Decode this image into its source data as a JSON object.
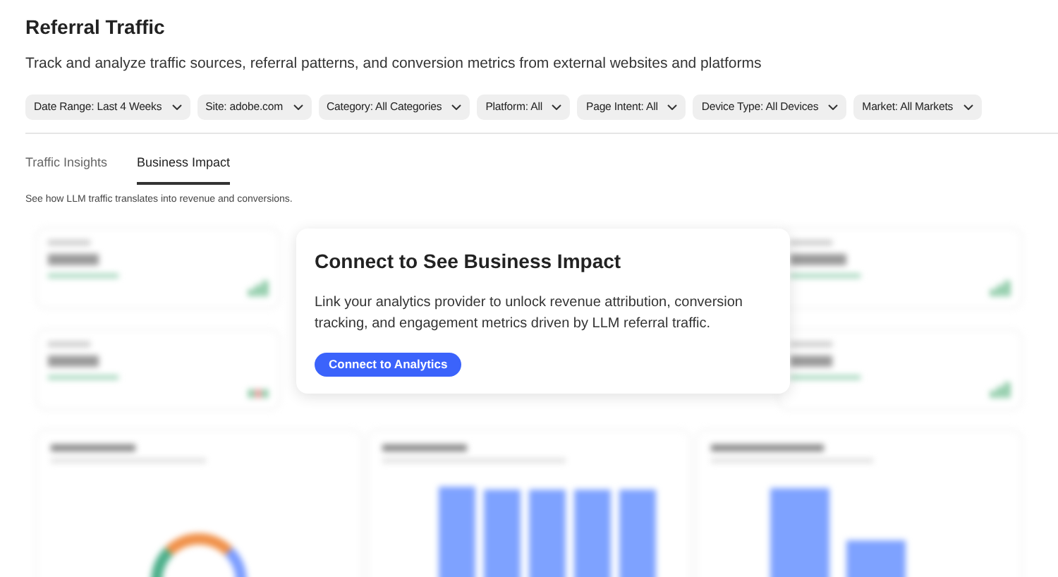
{
  "page": {
    "title": "Referral Traffic",
    "description": "Track and analyze traffic sources, referral patterns, and conversion metrics from external websites and platforms"
  },
  "filters": [
    {
      "label": "Date Range: Last 4 Weeks"
    },
    {
      "label": "Site: adobe.com"
    },
    {
      "label": "Category: All Categories"
    },
    {
      "label": "Platform: All"
    },
    {
      "label": "Page Intent: All"
    },
    {
      "label": "Device Type: All Devices"
    },
    {
      "label": "Market: All Markets"
    }
  ],
  "tabs": [
    {
      "label": "Traffic Insights",
      "selected": false
    },
    {
      "label": "Business Impact",
      "selected": true
    }
  ],
  "tab_caption": "See how LLM traffic translates into revenue and conversions.",
  "overlay": {
    "heading": "Connect to See Business Impact",
    "body": "Link your analytics provider to unlock revenue attribution, conversion tracking, and engagement metrics driven by LLM referral traffic.",
    "button": "Connect to Analytics"
  }
}
